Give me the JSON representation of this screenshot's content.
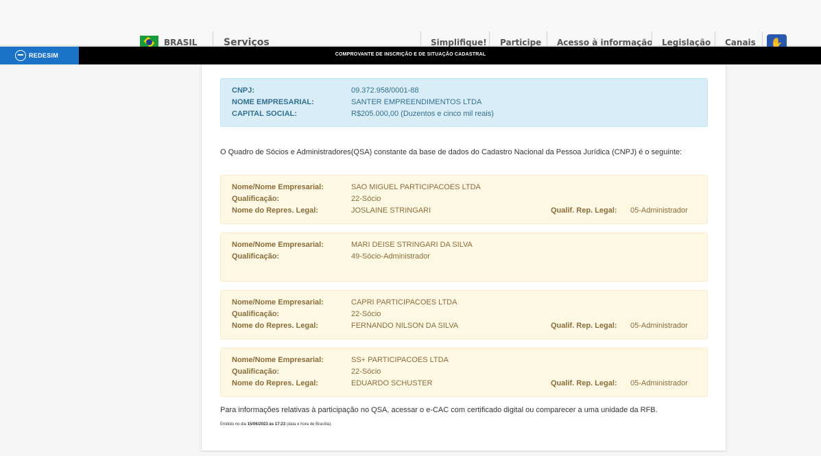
{
  "gov_bar": {
    "brasil": "BRASIL",
    "servicos": "Serviços",
    "menu": [
      "Simplifique!",
      "Participe",
      "Acesso à informação",
      "Legislação",
      "Canais"
    ]
  },
  "title_bar": {
    "logo_text": "REDESIM",
    "title": "COMPROVANTE DE INSCRIÇÃO E DE SITUAÇÃO CADASTRAL"
  },
  "company": {
    "cnpj_label": "CNPJ:",
    "cnpj": "09.372.958/0001-88",
    "name_label": "NOME EMPRESARIAL:",
    "name": "SANTER EMPREENDIMENTOS LTDA",
    "capital_label": "CAPITAL SOCIAL:",
    "capital": "R$205.000,00 (Duzentos e cinco mil reais)"
  },
  "qsa_intro": "O Quadro de Sócios e Administradores(QSA) constante da base de dados do Cadastro Nacional da Pessoa Jurídica (CNPJ) é o seguinte:",
  "labels": {
    "nome": "Nome/Nome Empresarial:",
    "qualificacao": "Qualificação:",
    "repres": "Nome do Repres. Legal:",
    "qualif_rep": "Qualif. Rep. Legal:"
  },
  "socios": [
    {
      "nome": "SAO MIGUEL PARTICIPACOES LTDA",
      "qualificacao": "22-Sócio",
      "repres": "JOSLAINE STRINGARI",
      "qualif_rep": "05-Administrador"
    },
    {
      "nome": "MARI DEISE STRINGARI DA SILVA",
      "qualificacao": "49-Sócio-Administrador"
    },
    {
      "nome": "CAPRI PARTICIPACOES LTDA",
      "qualificacao": "22-Sócio",
      "repres": "FERNANDO NILSON DA SILVA",
      "qualif_rep": "05-Administrador"
    },
    {
      "nome": "SS+ PARTICIPACOES LTDA",
      "qualificacao": "22-Sócio",
      "repres": "EDUARDO SCHUSTER",
      "qualif_rep": "05-Administrador"
    }
  ],
  "footer": {
    "info": "Para informações relativas à participação no QSA, acessar o e-CAC com certificado digital ou comparecer a uma unidade da RFB.",
    "emitido_prefix": "Emitido no dia",
    "emitido_datetime": "15/06/2023 às 17:23",
    "emitido_suffix": "(data e hora de Brasília)."
  }
}
